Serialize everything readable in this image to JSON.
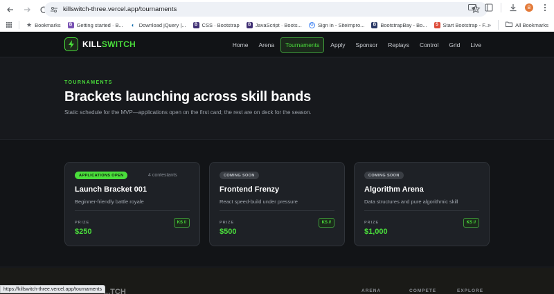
{
  "browser": {
    "url": "killswitch-three.vercel.app/tournaments",
    "profile_initial": "B",
    "bookmarks": [
      {
        "label": "Bookmarks",
        "icon": "star-icon",
        "color": "#5f6368"
      },
      {
        "label": "Getting started · B...",
        "icon": "bootstrap-icon",
        "color": "#7952b3"
      },
      {
        "label": "Download jQuery |...",
        "icon": "jquery-icon",
        "color": "#0769ad"
      },
      {
        "label": "CSS · Bootstrap",
        "icon": "bootstrap-icon",
        "color": "#3f2f73"
      },
      {
        "label": "JavaScript · Boots...",
        "icon": "bootstrap-icon",
        "color": "#3f2f73"
      },
      {
        "label": "Sign in - Siteimpro...",
        "icon": "google-icon",
        "color": "#4285f4"
      },
      {
        "label": "BootstrapBay - Bo...",
        "icon": "bootstrapbay-icon",
        "color": "#2b3a67"
      },
      {
        "label": "Start Bootstrap - F...",
        "icon": "startbootstrap-icon",
        "color": "#dd4b39"
      }
    ],
    "all_bookmarks": "All Bookmarks",
    "status_url": "https://killswitch-three.vercel.app/tournaments"
  },
  "site": {
    "brand_kill": "KILL",
    "brand_switch": "SWITCH",
    "accent": "#4ade3b",
    "nav": [
      {
        "label": "Home",
        "active": false
      },
      {
        "label": "Arena",
        "active": false
      },
      {
        "label": "Tournaments",
        "active": true
      },
      {
        "label": "Apply",
        "active": false
      },
      {
        "label": "Sponsor",
        "active": false
      },
      {
        "label": "Replays",
        "active": false
      },
      {
        "label": "Control",
        "active": false
      },
      {
        "label": "Grid",
        "active": false
      },
      {
        "label": "Live",
        "active": false
      }
    ]
  },
  "hero": {
    "eyebrow": "TOURNAMENTS",
    "title": "Brackets launching across skill bands",
    "subtitle": "Static schedule for the MVP—applications open on the first card; the rest are on deck for the season."
  },
  "cards": [
    {
      "badge": "APPLICATIONS OPEN",
      "badge_type": "open",
      "contestants": "4 contestants",
      "title": "Launch Bracket 001",
      "subtitle": "Beginner-friendly battle royale",
      "prize_label": "PRIZE",
      "prize": "$250",
      "tag": "KS //"
    },
    {
      "badge": "COMING SOON",
      "badge_type": "soon",
      "contestants": "",
      "title": "Frontend Frenzy",
      "subtitle": "React speed-build under pressure",
      "prize_label": "PRIZE",
      "prize": "$500",
      "tag": "KS //"
    },
    {
      "badge": "COMING SOON",
      "badge_type": "soon",
      "contestants": "",
      "title": "Algorithm Arena",
      "subtitle": "Data structures and pure algorithmic skill",
      "prize_label": "PRIZE",
      "prize": "$1,000",
      "tag": "KS //"
    }
  ],
  "footer": {
    "logo_partial": "...TCH",
    "columns": [
      "ARENA",
      "COMPETE",
      "EXPLORE"
    ]
  }
}
